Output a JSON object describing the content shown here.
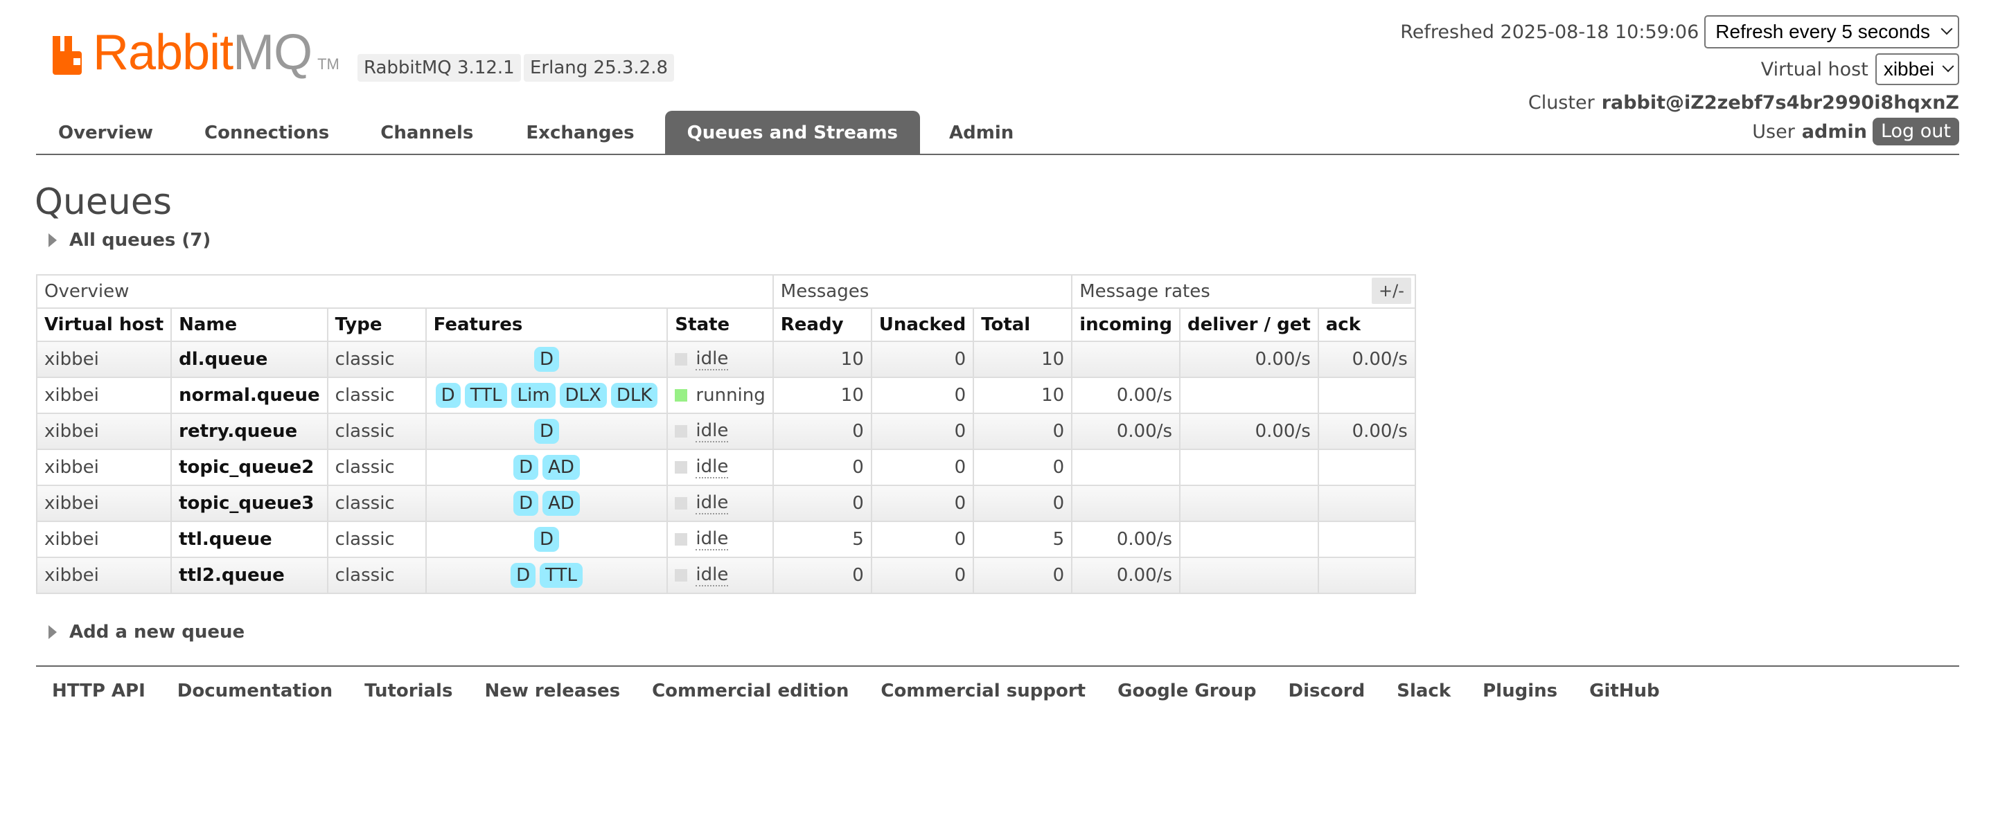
{
  "brand": {
    "logo_rabbit": "Rabbit",
    "logo_mq": "MQ",
    "logo_tm": "TM",
    "color": "#ff6600"
  },
  "versions": {
    "rabbitmq": "RabbitMQ 3.12.1",
    "erlang": "Erlang 25.3.2.8"
  },
  "header": {
    "refreshed_label": "Refreshed 2025-08-18 10:59:06",
    "refresh_select": "Refresh every 5 seconds",
    "vhost_label": "Virtual host",
    "vhost_select": "xibbei",
    "cluster_label": "Cluster",
    "cluster_name": "rabbit@iZ2zebf7s4br2990i8hqxnZ",
    "user_label": "User",
    "user_name": "admin",
    "logout": "Log out"
  },
  "nav": {
    "tabs": [
      {
        "label": "Overview",
        "active": false
      },
      {
        "label": "Connections",
        "active": false
      },
      {
        "label": "Channels",
        "active": false
      },
      {
        "label": "Exchanges",
        "active": false
      },
      {
        "label": "Queues and Streams",
        "active": true
      },
      {
        "label": "Admin",
        "active": false
      }
    ]
  },
  "page": {
    "title": "Queues",
    "all_queues": "All queues (7)",
    "add_queue": "Add a new queue",
    "columns_toggle": "+/-"
  },
  "table": {
    "groups": {
      "overview": "Overview",
      "messages": "Messages",
      "rates": "Message rates"
    },
    "columns": [
      "Virtual host",
      "Name",
      "Type",
      "Features",
      "State",
      "Ready",
      "Unacked",
      "Total",
      "incoming",
      "deliver / get",
      "ack"
    ],
    "rows": [
      {
        "vhost": "xibbei",
        "name": "dl.queue",
        "type": "classic",
        "features": [
          "D"
        ],
        "state": "idle",
        "ready": "10",
        "unacked": "0",
        "total": "10",
        "incoming": "",
        "deliver": "0.00/s",
        "ack": "0.00/s"
      },
      {
        "vhost": "xibbei",
        "name": "normal.queue",
        "type": "classic",
        "features": [
          "D",
          "TTL",
          "Lim",
          "DLX",
          "DLK"
        ],
        "state": "running",
        "ready": "10",
        "unacked": "0",
        "total": "10",
        "incoming": "0.00/s",
        "deliver": "",
        "ack": ""
      },
      {
        "vhost": "xibbei",
        "name": "retry.queue",
        "type": "classic",
        "features": [
          "D"
        ],
        "state": "idle",
        "ready": "0",
        "unacked": "0",
        "total": "0",
        "incoming": "0.00/s",
        "deliver": "0.00/s",
        "ack": "0.00/s"
      },
      {
        "vhost": "xibbei",
        "name": "topic_queue2",
        "type": "classic",
        "features": [
          "D",
          "AD"
        ],
        "state": "idle",
        "ready": "0",
        "unacked": "0",
        "total": "0",
        "incoming": "",
        "deliver": "",
        "ack": ""
      },
      {
        "vhost": "xibbei",
        "name": "topic_queue3",
        "type": "classic",
        "features": [
          "D",
          "AD"
        ],
        "state": "idle",
        "ready": "0",
        "unacked": "0",
        "total": "0",
        "incoming": "",
        "deliver": "",
        "ack": ""
      },
      {
        "vhost": "xibbei",
        "name": "ttl.queue",
        "type": "classic",
        "features": [
          "D"
        ],
        "state": "idle",
        "ready": "5",
        "unacked": "0",
        "total": "5",
        "incoming": "0.00/s",
        "deliver": "",
        "ack": ""
      },
      {
        "vhost": "xibbei",
        "name": "ttl2.queue",
        "type": "classic",
        "features": [
          "D",
          "TTL"
        ],
        "state": "idle",
        "ready": "0",
        "unacked": "0",
        "total": "0",
        "incoming": "0.00/s",
        "deliver": "",
        "ack": ""
      }
    ]
  },
  "footer": {
    "links": [
      "HTTP API",
      "Documentation",
      "Tutorials",
      "New releases",
      "Commercial edition",
      "Commercial support",
      "Google Group",
      "Discord",
      "Slack",
      "Plugins",
      "GitHub"
    ]
  }
}
